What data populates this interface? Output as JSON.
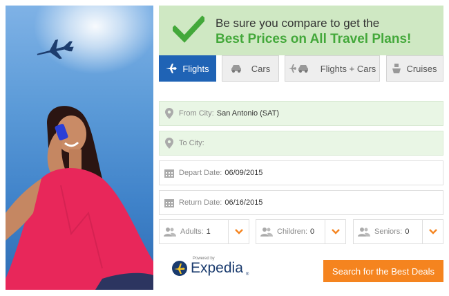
{
  "banner": {
    "line1": "Be sure you compare to get the",
    "line2": "Best Prices on All Travel Plans!"
  },
  "tabs": [
    {
      "label": "Flights",
      "icon": "airplane-icon",
      "active": true
    },
    {
      "label": "Cars",
      "icon": "car-icon",
      "active": false
    },
    {
      "label": "Flights + Cars",
      "icon": "airplane-car-icon",
      "active": false
    },
    {
      "label": "Cruises",
      "icon": "cruise-ship-icon",
      "active": false
    }
  ],
  "fields": {
    "from_city": {
      "label": "From City:",
      "value": "San Antonio (SAT)"
    },
    "to_city": {
      "label": "To City:",
      "value": ""
    },
    "depart_date": {
      "label": "Depart Date:",
      "value": "06/09/2015"
    },
    "return_date": {
      "label": "Return Date:",
      "value": "06/16/2015"
    }
  },
  "travelers": {
    "adults": {
      "label": "Adults:",
      "value": "1"
    },
    "children": {
      "label": "Children:",
      "value": "0"
    },
    "seniors": {
      "label": "Seniors:",
      "value": "0"
    }
  },
  "footer": {
    "powered_by": "Powered by",
    "brand": "Expedia",
    "trademark": "®",
    "cta": "Search for the Best Deals"
  },
  "colors": {
    "banner_bg": "#cfe8c3",
    "accent_green": "#43a83a",
    "tab_active": "#1f63b5",
    "cta_orange": "#f5841f",
    "field_green": "#e9f6e5"
  }
}
